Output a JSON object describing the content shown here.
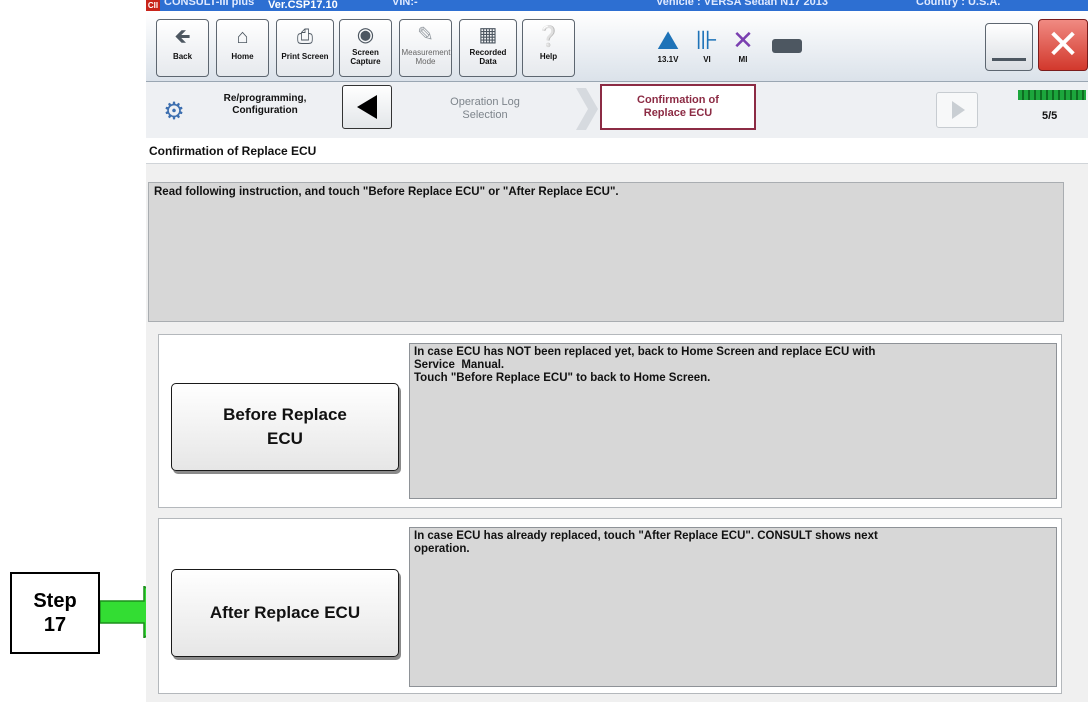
{
  "titlebar": {
    "app_name": "CONSULT-III plus",
    "version": "Ver.CSP17.10",
    "vin": "VIN:-",
    "vehicle": "Vehicle : VERSA Sedan N17 2013",
    "country": "Country : U.S.A."
  },
  "toolbar": {
    "buttons": [
      {
        "label": "Back",
        "icon": "back-arrow-icon"
      },
      {
        "label": "Home",
        "icon": "home-icon"
      },
      {
        "label": "Print Screen",
        "icon": "printer-icon"
      },
      {
        "label": "Screen Capture",
        "icon": "camera-icon"
      },
      {
        "label": "Measurement Mode",
        "icon": "measurement-icon"
      },
      {
        "label": "Recorded Data",
        "icon": "recorded-data-icon"
      },
      {
        "label": "Help",
        "icon": "help-icon"
      }
    ],
    "status": [
      {
        "label": "13.1V",
        "icon": "car-battery-icon"
      },
      {
        "label": "VI",
        "icon": "vi-antenna-icon"
      },
      {
        "label": "MI",
        "icon": "mi-cross-icon"
      }
    ]
  },
  "nav": {
    "section_label": "Re/programming, Configuration",
    "step_prev": "Operation Log Selection",
    "step_current": "Confirmation of Replace ECU",
    "page_count": "5/5"
  },
  "page": {
    "title": "Confirmation of Replace ECU",
    "instruction": "Read following instruction, and touch \"Before Replace ECU\" or \"After Replace ECU\"."
  },
  "before_card": {
    "button_line1": "Before Replace",
    "button_line2": "ECU",
    "desc_line1": "In case ECU has NOT been replaced yet, back to Home Screen and replace ECU with",
    "desc_line2": "Service  Manual.",
    "desc_line3": "Touch \"Before Replace ECU\" to back to Home Screen."
  },
  "after_card": {
    "button_label": "After Replace ECU",
    "desc_line1": "In case ECU has already replaced, touch \"After Replace ECU\". CONSULT shows next",
    "desc_line2": "operation."
  },
  "callout": {
    "line1": "Step",
    "line2": "17"
  },
  "colors": {
    "titlebar": "#2d6fd2",
    "active_step": "#8c2b44",
    "close_button": "#d2382c",
    "callout_arrow": "#33dd33",
    "progress": "#1ca63c"
  }
}
